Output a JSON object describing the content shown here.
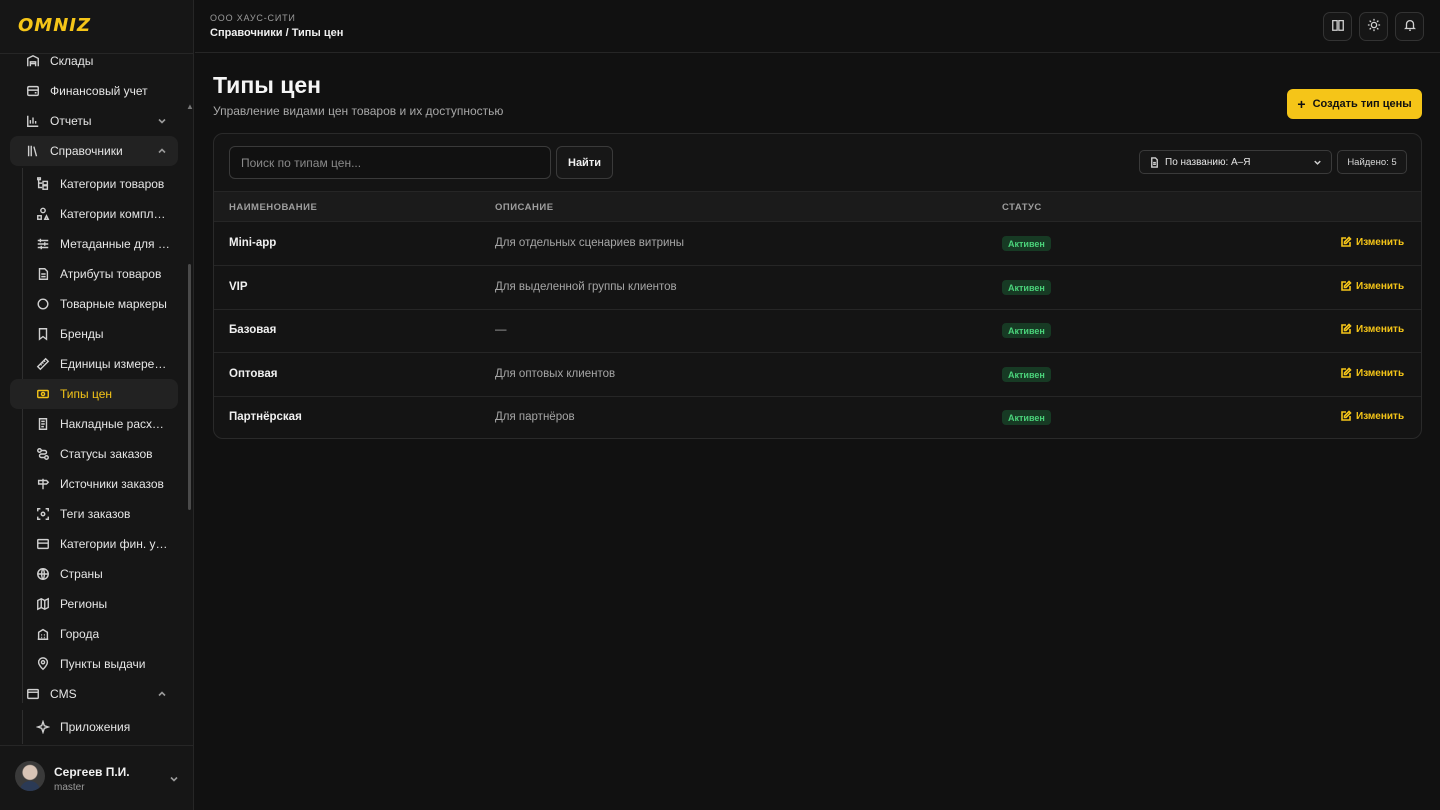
{
  "brand": {
    "logo": "OMNIZ",
    "accent": "#f5c518"
  },
  "header": {
    "org": "ООО ХАУС-СИТИ",
    "breadcrumb": "Справочники / Типы цен",
    "buttons": [
      "book-icon",
      "sun-icon",
      "bell-icon"
    ]
  },
  "sidebar": {
    "items": [
      {
        "label": "Склады",
        "icon": "warehouse-icon"
      },
      {
        "label": "Финансовый учет",
        "icon": "wallet-icon"
      },
      {
        "label": "Отчеты",
        "icon": "chart-icon",
        "expandable": true
      },
      {
        "label": "Справочники",
        "icon": "library-icon",
        "expandable": true,
        "open": true
      }
    ],
    "sub_items": [
      {
        "label": "Категории товаров",
        "icon": "tree-icon"
      },
      {
        "label": "Категории комплектов",
        "icon": "shapes-icon"
      },
      {
        "label": "Метаданные для вариантов",
        "icon": "sliders-icon"
      },
      {
        "label": "Атрибуты товаров",
        "icon": "file-icon"
      },
      {
        "label": "Товарные маркеры",
        "icon": "circle-icon"
      },
      {
        "label": "Бренды",
        "icon": "bookmark-icon"
      },
      {
        "label": "Единицы измерения",
        "icon": "ruler-icon"
      },
      {
        "label": "Типы цен",
        "icon": "banknote-icon",
        "active": true
      },
      {
        "label": "Накладные расходы",
        "icon": "receipt-icon"
      },
      {
        "label": "Статусы заказов",
        "icon": "route-icon"
      },
      {
        "label": "Источники заказов",
        "icon": "signpost-icon"
      },
      {
        "label": "Теги заказов",
        "icon": "tag-scan-icon"
      },
      {
        "label": "Категории фин. учета",
        "icon": "card-icon"
      },
      {
        "label": "Страны",
        "icon": "globe-icon"
      },
      {
        "label": "Регионы",
        "icon": "map-icon"
      },
      {
        "label": "Города",
        "icon": "building-icon"
      },
      {
        "label": "Пункты выдачи",
        "icon": "pin-icon"
      }
    ],
    "cms": {
      "label": "CMS",
      "icon": "browser-icon"
    },
    "cms_items": [
      {
        "label": "Приложения",
        "icon": "sparkle-icon"
      }
    ],
    "user": {
      "name": "Сергеев П.И.",
      "role": "master"
    }
  },
  "main": {
    "title": "Типы цен",
    "subtitle": "Управление видами цен товаров и их доступностью",
    "create_label": "Создать тип цены",
    "search": {
      "placeholder": "Поиск по типам цен...",
      "value": ""
    },
    "find_label": "Найти",
    "sort_label": "По названию: А–Я",
    "found_label": "Найдено: 5",
    "columns": [
      "НАИМЕНОВАНИЕ",
      "ОПИСАНИЕ",
      "СТАТУС"
    ],
    "rows": [
      {
        "name": "Mini-app",
        "description": "Для отдельных сценариев витрины",
        "status": "Активен",
        "action": "Изменить"
      },
      {
        "name": "VIP",
        "description": "Для выделенной группы клиентов",
        "status": "Активен",
        "action": "Изменить"
      },
      {
        "name": "Базовая",
        "description": "—",
        "status": "Активен",
        "action": "Изменить"
      },
      {
        "name": "Оптовая",
        "description": "Для оптовых клиентов",
        "status": "Активен",
        "action": "Изменить"
      },
      {
        "name": "Партнёрская",
        "description": "Для партнёров",
        "status": "Активен",
        "action": "Изменить"
      }
    ]
  }
}
